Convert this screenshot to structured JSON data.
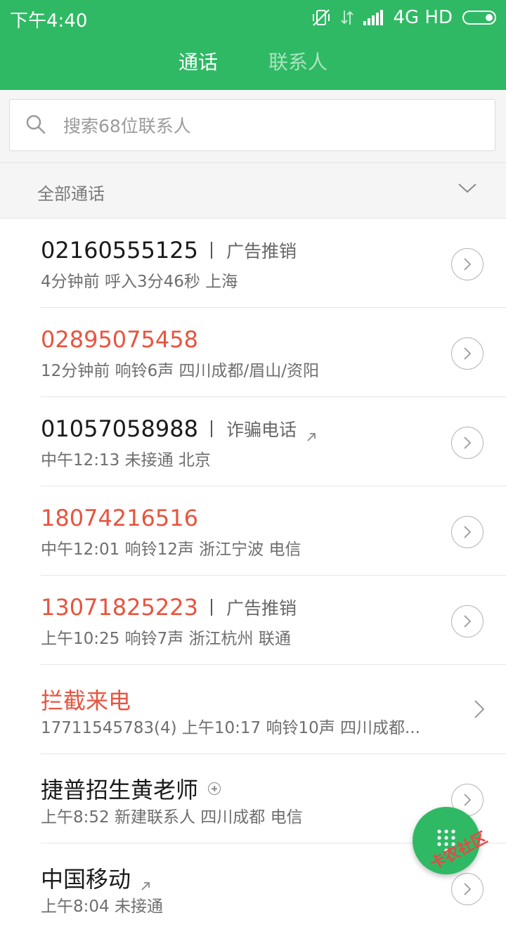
{
  "status_bar": {
    "time": "下午4:40",
    "network": "4G HD"
  },
  "tabs": [
    {
      "label": "通话",
      "active": true
    },
    {
      "label": "联系人",
      "active": false
    }
  ],
  "search": {
    "placeholder": "搜索68位联系人"
  },
  "filter": {
    "label": "全部通话"
  },
  "calls": [
    {
      "name": "02160555125",
      "tag": "广告推销",
      "detail": "4分钟前 呼入3分46秒 上海",
      "missed": false
    },
    {
      "name": "02895075458",
      "tag": "",
      "detail": "12分钟前 响铃6声 四川成都/眉山/资阳",
      "missed": true
    },
    {
      "name": "01057058988",
      "tag": "诈骗电话",
      "detail": "中午12:13 未接通 北京",
      "missed": false
    },
    {
      "name": "18074216516",
      "tag": "",
      "detail": "中午12:01 响铃12声 浙江宁波 电信",
      "missed": true
    },
    {
      "name": "13071825223",
      "tag": "广告推销",
      "detail": "上午10:25 响铃7声 浙江杭州 联通",
      "missed": true
    },
    {
      "name": "拦截来电",
      "tag": "",
      "detail": "17711545783(4) 上午10:17 响铃10声 四川成都...",
      "missed": true
    },
    {
      "name": "捷普招生黄老师",
      "tag": "",
      "detail": "上午8:52 新建联系人 四川成都 电信",
      "missed": false
    },
    {
      "name": "中国移动",
      "tag": "",
      "detail": "上午8:04 未接通",
      "missed": false
    }
  ],
  "watermark": {
    "text": "卡农社区"
  },
  "colors": {
    "brand_green": "#2fb964",
    "missed_red": "#e8543f"
  }
}
